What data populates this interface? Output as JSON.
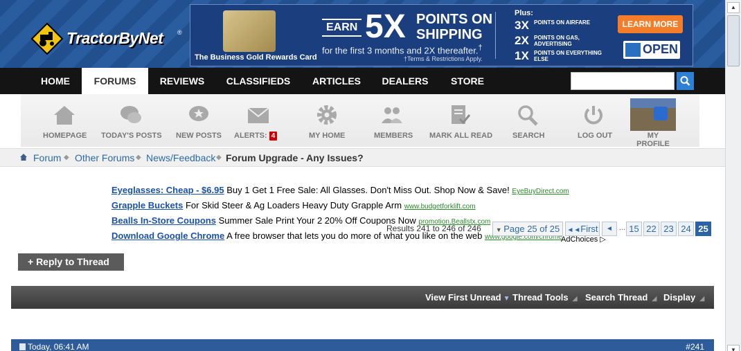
{
  "logo": {
    "text": "TractorByNet",
    "tm": "®"
  },
  "banner": {
    "card_label": "The Business Gold Rewards Card",
    "earn": "EARN",
    "big": "5X",
    "points_line1": "POINTS ON",
    "points_line2": "SHIPPING",
    "first_months": "for the first 3 months and 2X thereafter.",
    "dagger": "†",
    "terms": "†Terms & Restrictions Apply.",
    "plus": "Plus:",
    "tiers": [
      {
        "mult": "3X",
        "desc": "POINTS ON AIRFARE"
      },
      {
        "mult": "2X",
        "desc": "POINTS ON GAS, ADVERTISING"
      },
      {
        "mult": "1X",
        "desc": "POINTS ON EVERYTHING ELSE"
      }
    ],
    "learn_more": "LEARN MORE",
    "open": "OPEN"
  },
  "nav": {
    "tabs": [
      {
        "label": "HOME"
      },
      {
        "label": "FORUMS"
      },
      {
        "label": "REVIEWS"
      },
      {
        "label": "CLASSIFIEDS"
      },
      {
        "label": "ARTICLES"
      },
      {
        "label": "DEALERS"
      },
      {
        "label": "STORE"
      }
    ],
    "active": "FORUMS",
    "search_placeholder": ""
  },
  "toolbar": {
    "items": [
      {
        "label": "HOMEPAGE",
        "icon": "house-icon"
      },
      {
        "label": "TODAY'S POSTS",
        "icon": "chat-bubbles-icon"
      },
      {
        "label": "NEW POSTS",
        "icon": "chat-star-icon"
      },
      {
        "label": "ALERTS:",
        "icon": "envelope-icon",
        "badge": "4"
      },
      {
        "label": "MY HOME",
        "icon": "gear-icon"
      },
      {
        "label": "MEMBERS",
        "icon": "people-icon"
      },
      {
        "label": "MARK ALL READ",
        "icon": "document-check-icon"
      },
      {
        "label": "SEARCH",
        "icon": "magnifier-icon"
      },
      {
        "label": "LOG OUT",
        "icon": "power-icon"
      }
    ],
    "profile_label": "MY PROFILE"
  },
  "breadcrumb": {
    "items": [
      "Forum",
      "Other Forums",
      "News/Feedback"
    ],
    "current": "Forum Upgrade - Any Issues?"
  },
  "ads": [
    {
      "title": "Eyeglasses: Cheap - $6.95",
      "desc": "Buy 1 Get 1 Free Sale: All Glasses. Don't Miss Out. Shop Now & Save!",
      "url": "EyeBuyDirect.com"
    },
    {
      "title": "Grapple Buckets",
      "desc": "For Skid Steer & Ag Loaders Heavy Duty Grapple Arm",
      "url": "www.budgetforklift.com"
    },
    {
      "title": "Bealls In-Store Coupons",
      "desc": "Summer Sale Print Your 2 20% Off Coupons Now",
      "url": "promotion.Beallstx.com"
    },
    {
      "title": "Download Google Chrome",
      "desc": "A free browser that lets you do more of what you like on the web",
      "url": "www.google.com/chrome"
    }
  ],
  "adchoices": "AdChoices ▷",
  "pagination": {
    "results": "Results 241 to 246 of 246",
    "page_of": "Page 25 of 25",
    "first": "First",
    "prev": "◄",
    "ellipsis": "...",
    "pages": [
      "15",
      "22",
      "23",
      "24"
    ],
    "current": "25"
  },
  "reply_button": "+ Reply to Thread",
  "thread_bar": {
    "view_first_unread": "View First Unread",
    "thread_tools": "Thread Tools",
    "search_thread": "Search Thread",
    "display": "Display"
  },
  "post": {
    "date": "Today, 06:41 AM",
    "number": "#241"
  }
}
